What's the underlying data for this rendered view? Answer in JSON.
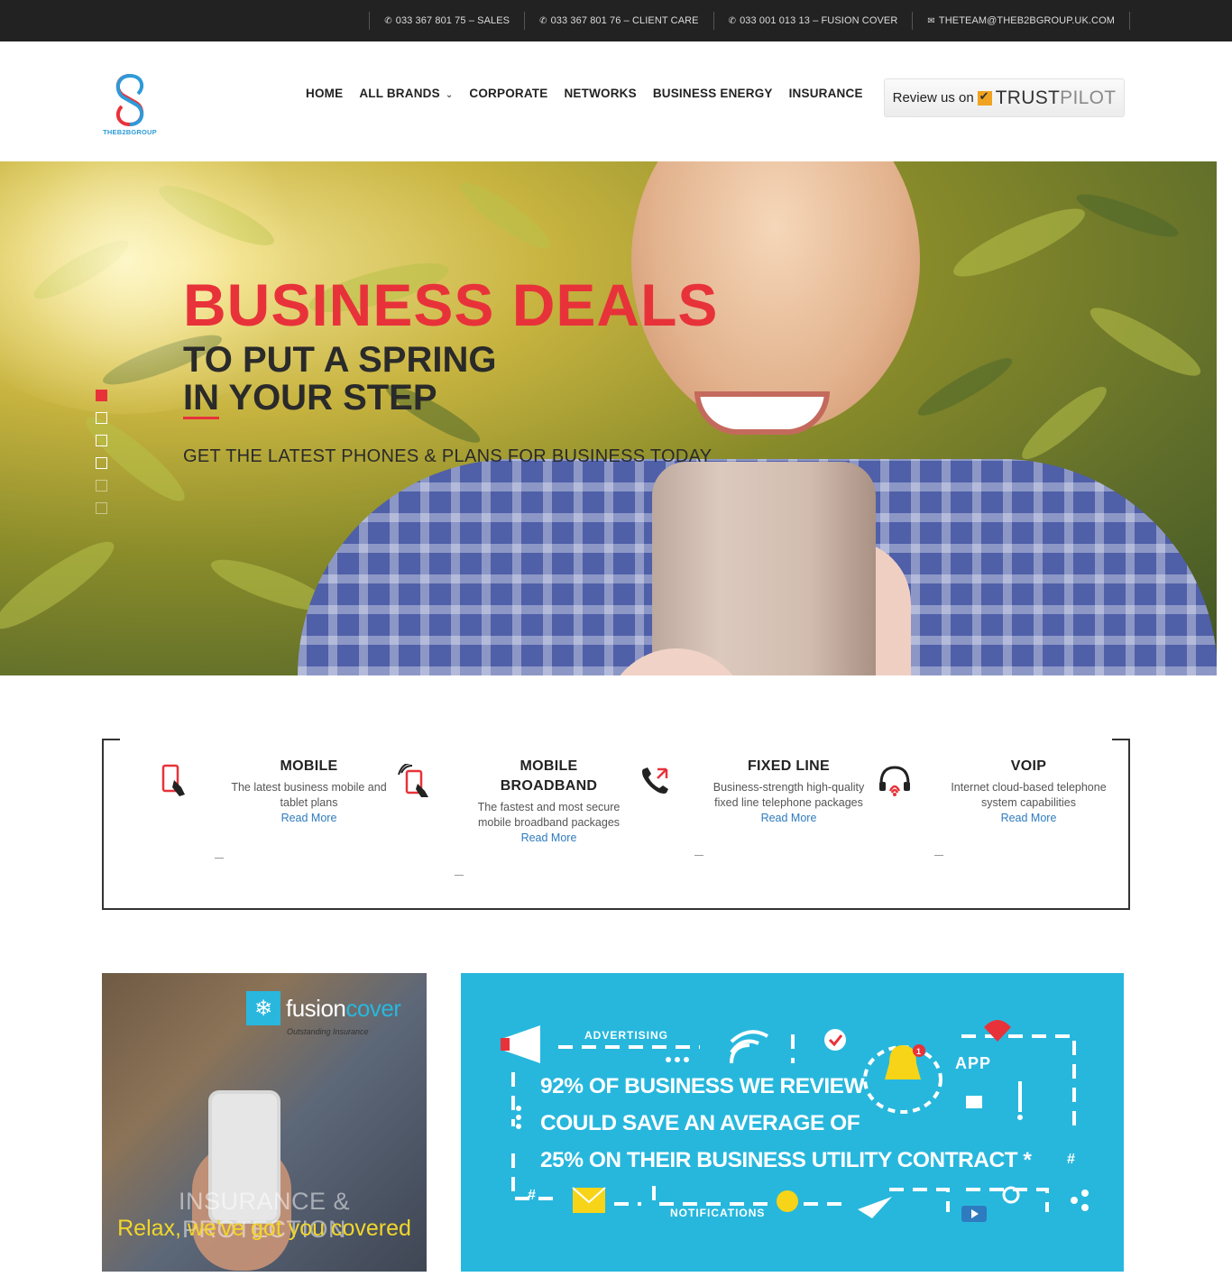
{
  "topbar": {
    "contacts": [
      {
        "icon": "phone-icon",
        "label": "033 367 801 75 – SALES"
      },
      {
        "icon": "phone-icon",
        "label": "033 367 801 76 – CLIENT CARE"
      },
      {
        "icon": "phone-icon",
        "label": "033 001 013 13 – FUSION COVER"
      },
      {
        "icon": "envelope-icon",
        "label": "THETEAM@THEB2BGROUP.UK.COM"
      }
    ]
  },
  "header": {
    "logo_text": "THEB2BGROUP",
    "nav": [
      {
        "label": "HOME"
      },
      {
        "label": "ALL BRANDS",
        "has_dropdown": true
      },
      {
        "label": "CORPORATE"
      },
      {
        "label": "NETWORKS"
      },
      {
        "label": "BUSINESS ENERGY"
      },
      {
        "label": "INSURANCE"
      }
    ],
    "trustpilot": {
      "prefix": "Review us on",
      "brand_a": "TRUST",
      "brand_b": "PILOT"
    }
  },
  "hero": {
    "title": "BUSINESS DEALS",
    "subtitle_line1": "TO PUT A SPRING",
    "subtitle_line2": "IN YOUR STEP",
    "tagline": "GET THE LATEST PHONES & PLANS FOR BUSINESS TODAY",
    "slides_count": 6,
    "active_slide": 1,
    "colors": {
      "accent": "#e8323a",
      "dark": "#2a2a2a"
    }
  },
  "services": [
    {
      "icon": "mobile-phone-icon",
      "title": "MOBILE",
      "description": "The latest business mobile and tablet plans",
      "link": "Read More"
    },
    {
      "icon": "mobile-broadband-icon",
      "title": "MOBILE BROADBAND",
      "description": "The fastest and most secure mobile broadband packages",
      "link": "Read More"
    },
    {
      "icon": "phone-call-icon",
      "title": "FIXED LINE",
      "description": "Business-strength high-quality fixed line telephone packages",
      "link": "Read More"
    },
    {
      "icon": "headset-icon",
      "title": "VOIP",
      "description": "Internet cloud-based telephone system capabilities",
      "link": "Read More"
    }
  ],
  "promo_left": {
    "brand_a": "fusion",
    "brand_b": "cover",
    "brand_tag": "Outstanding Insurance",
    "heading": "INSURANCE & PROTECTION",
    "tagline": "Relax, we've got you covered"
  },
  "promo_right": {
    "line1": "92% OF BUSINESS WE REVIEW",
    "line2": "COULD SAVE AN AVERAGE OF",
    "line3": "25% ON THEIR BUSINESS  UTILITY  CONTRACT *",
    "label_advertising": "ADVERTISING",
    "label_app": "APP",
    "label_notifications": "NOTIFICATIONS",
    "hash": "#",
    "bell_count": "1",
    "background": "#27b7dd"
  }
}
